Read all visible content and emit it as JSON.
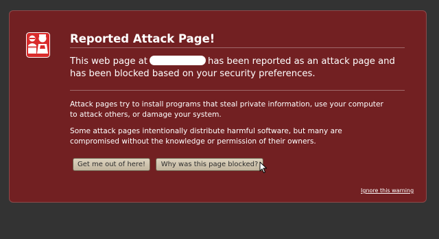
{
  "dialog": {
    "title": "Reported Attack Page!",
    "lead_before": "This web page at",
    "lead_after": "has been reported as an attack page and has been blocked based on your security preferences.",
    "paragraph1": "Attack pages try to install programs that steal private information, use your computer to attack others, or damage your system.",
    "paragraph2": "Some attack pages intentionally distribute harmful software, but many are compromised without the knowledge or permission of their owners.",
    "buttons": {
      "get_me_out": "Get me out of here!",
      "why_blocked": "Why was this page blocked?"
    },
    "ignore_link": "Ignore this warning"
  },
  "icons": {
    "badge": "attacker-badge-icon",
    "cursor": "mouse-pointer-icon"
  },
  "colors": {
    "page_background": "#333333",
    "panel_background": "#722022",
    "badge_red": "#d92b2b",
    "button_face": "#d0c5b0",
    "text": "#ffffff"
  }
}
